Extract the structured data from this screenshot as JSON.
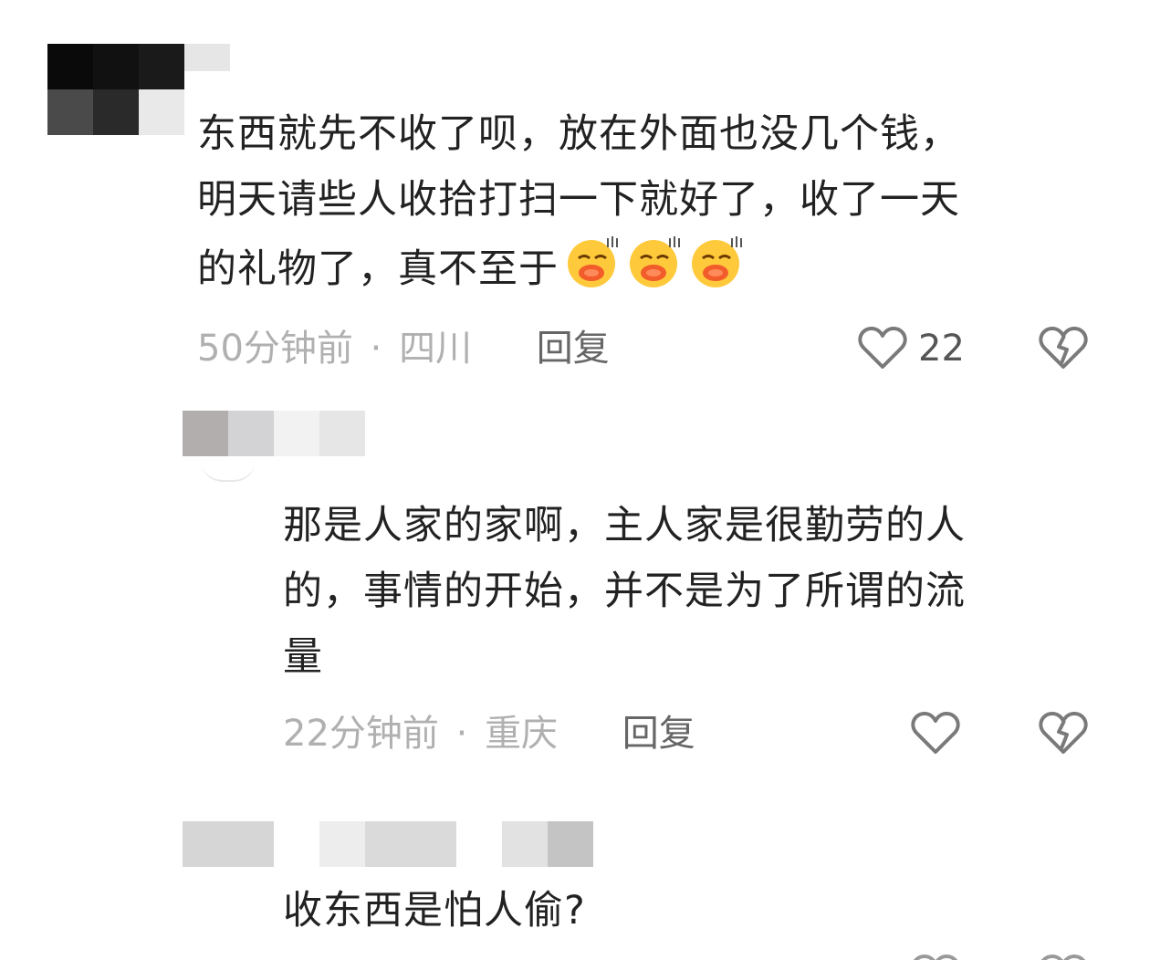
{
  "comments": [
    {
      "text_lines": [
        "东西就先不收了呗，放在外面也没几个钱，",
        "明天请些人收拾打扫一下就好了，收了一天",
        "的礼物了，真不至于"
      ],
      "emoji_count": 3,
      "time": "50分钟前",
      "location": "四川",
      "reply_label": "回复",
      "like_count": "22"
    },
    {
      "text_lines": [
        "那是人家的家啊，主人家是很勤劳的人",
        "的，事情的开始，并不是为了所谓的流",
        "量"
      ],
      "time": "22分钟前",
      "location": "重庆",
      "reply_label": "回复"
    },
    {
      "text_lines": [
        "收东西是怕人偷?"
      ]
    }
  ],
  "separator": "·",
  "icons": {
    "like": "heart-outline-icon",
    "dislike": "broken-heart-icon",
    "emoji": "blushing-kiss-emoji"
  },
  "colors": {
    "text": "#222222",
    "meta": "#b0b0b0",
    "reply": "#666666",
    "icon": "#7a7a7a"
  }
}
